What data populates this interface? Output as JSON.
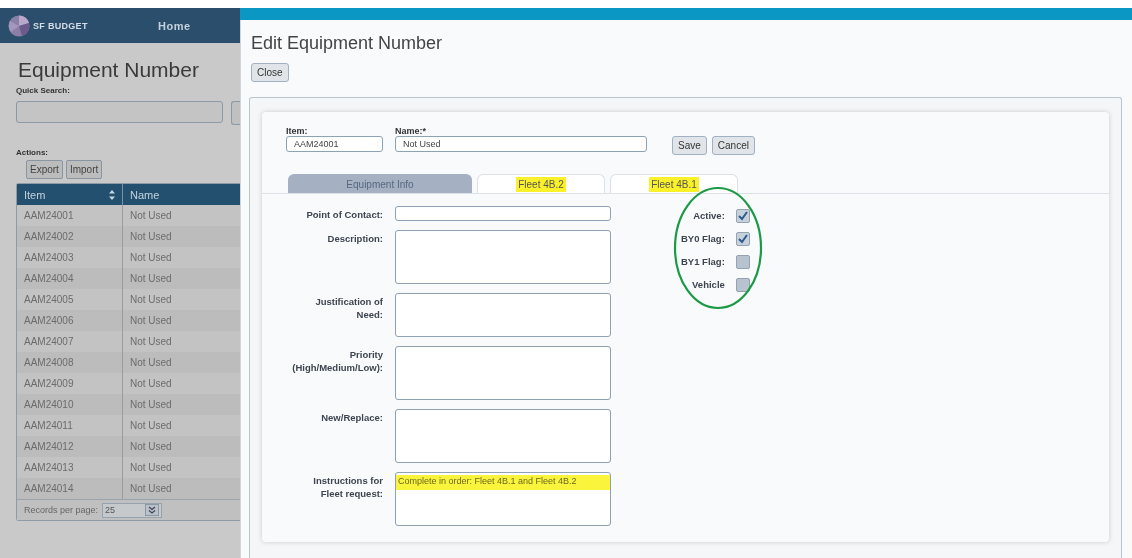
{
  "app": {
    "brand": "SF BUDGET",
    "nav": [
      {
        "label": "Home"
      }
    ]
  },
  "page": {
    "title": "Equipment Number",
    "quick_search_label": "Quick Search:",
    "actions_label": "Actions:",
    "actions": [
      "Export",
      "Import"
    ]
  },
  "table": {
    "columns": [
      {
        "label": "Item",
        "sortable": true
      },
      {
        "label": "Name"
      }
    ],
    "rows": [
      [
        "AAM24001",
        "Not Used"
      ],
      [
        "AAM24002",
        "Not Used"
      ],
      [
        "AAM24003",
        "Not Used"
      ],
      [
        "AAM24004",
        "Not Used"
      ],
      [
        "AAM24005",
        "Not Used"
      ],
      [
        "AAM24006",
        "Not Used"
      ],
      [
        "AAM24007",
        "Not Used"
      ],
      [
        "AAM24008",
        "Not Used"
      ],
      [
        "AAM24009",
        "Not Used"
      ],
      [
        "AAM24010",
        "Not Used"
      ],
      [
        "AAM24011",
        "Not Used"
      ],
      [
        "AAM24012",
        "Not Used"
      ],
      [
        "AAM24013",
        "Not Used"
      ],
      [
        "AAM24014",
        "Not Used"
      ]
    ],
    "footer": {
      "label": "Records per page:",
      "value": "25"
    }
  },
  "dialog": {
    "title": "Edit Equipment Number",
    "close": "Close",
    "item": {
      "label": "Item:",
      "value": "AAM24001"
    },
    "name": {
      "label": "Name:*",
      "value": "Not Used"
    },
    "buttons": [
      "Save",
      "Cancel"
    ],
    "tabs": [
      {
        "label": "Equipment Info",
        "selected": true,
        "highlighted": false
      },
      {
        "label": "Fleet 4B.2",
        "selected": false,
        "highlighted": true
      },
      {
        "label": "Fleet 4B.1",
        "selected": false,
        "highlighted": true
      }
    ],
    "fields": [
      {
        "label": "Point of Contact:",
        "kind": "line"
      },
      {
        "label": "Description:",
        "kind": "area"
      },
      {
        "label": "Justification of Need:",
        "kind": "short"
      },
      {
        "label": "Priority (High/Medium/Low):",
        "kind": "area"
      },
      {
        "label": "New/Replace:",
        "kind": "area"
      },
      {
        "label": "Instructions for Fleet request:",
        "kind": "area",
        "value": "Complete in order: Fleet 4B.1 and Fleet 4B.2",
        "highlighted": true
      }
    ],
    "flags": [
      {
        "label": "Active:",
        "checked": true
      },
      {
        "label": "BY0 Flag:",
        "checked": true
      },
      {
        "label": "BY1 Flag:",
        "checked": false
      },
      {
        "label": "Vehicle",
        "checked": false
      }
    ]
  }
}
